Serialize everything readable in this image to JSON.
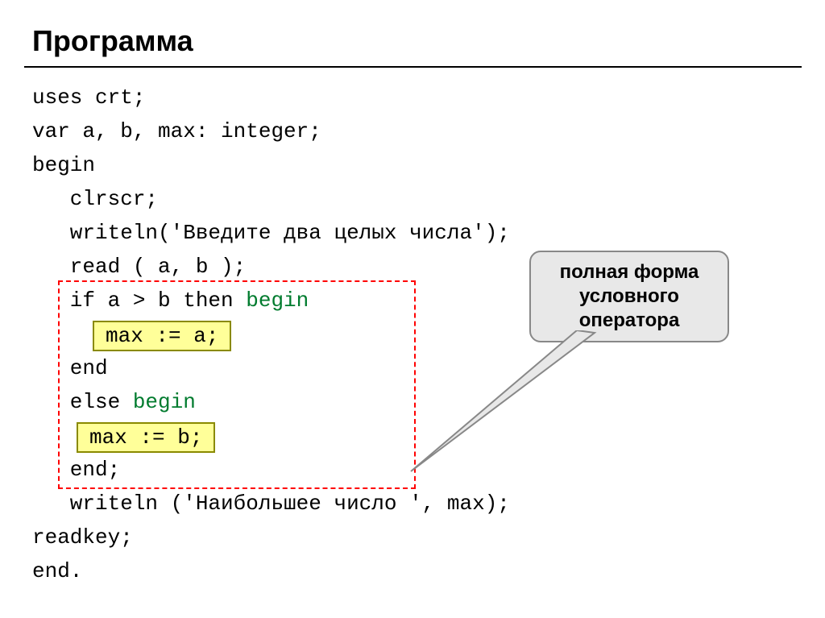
{
  "title": "Программа",
  "code": {
    "l1": "uses crt;",
    "l2": "var a, b, max: integer;",
    "l3": "begin",
    "l4": "   clrscr;",
    "l5": "   writeln('Введите два целых числа');",
    "l6": "   read ( a, b );",
    "l7a": "   if a > b then ",
    "l7b": "begin",
    "l8": "",
    "l9": "   end",
    "l10a": "   else ",
    "l10b": "begin",
    "l11": "",
    "l12": "   end;",
    "l13": "   writeln ('Наибольшее число ', max);",
    "l14": "readkey;",
    "l15": "end."
  },
  "box_a": "max := a;",
  "box_b": "max := b;",
  "callout": {
    "line1": "полная форма",
    "line2": "условного",
    "line3": "оператора"
  }
}
